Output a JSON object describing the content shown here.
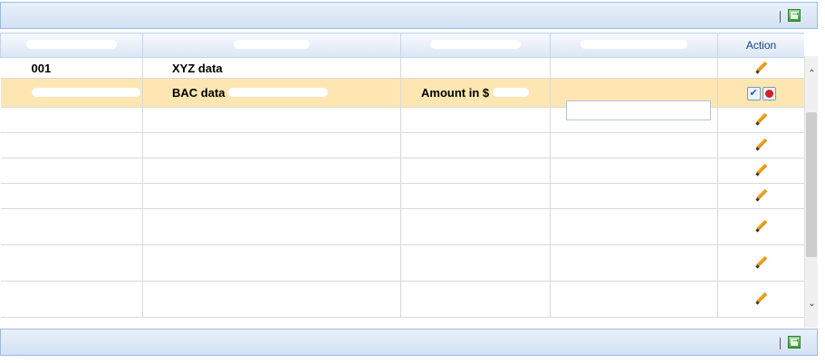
{
  "toolbar": {
    "export_icon": "export-to-excel-icon"
  },
  "grid": {
    "columns": [
      "",
      "",
      "",
      "",
      "Action"
    ],
    "rows": [
      {
        "col1": "001",
        "col2": "XYZ data",
        "col3": "",
        "selected": false
      },
      {
        "col1": "",
        "col2": "BAC data",
        "col3": "Amount in $",
        "selected": true
      },
      {
        "col1": "",
        "col2": "",
        "col3": "",
        "selected": false
      },
      {
        "col1": "",
        "col2": "",
        "col3": "",
        "selected": false
      },
      {
        "col1": "",
        "col2": "",
        "col3": "",
        "selected": false
      },
      {
        "col1": "",
        "col2": "",
        "col3": "",
        "selected": false
      },
      {
        "col1": "",
        "col2": "",
        "col3": "",
        "selected": false
      },
      {
        "col1": "",
        "col2": "",
        "col3": "",
        "selected": false
      },
      {
        "col1": "",
        "col2": "",
        "col3": "",
        "selected": false
      }
    ],
    "edit_input_value": "",
    "colors": {
      "selected_row": "#fde6b2",
      "header_text": "#15428b"
    }
  }
}
